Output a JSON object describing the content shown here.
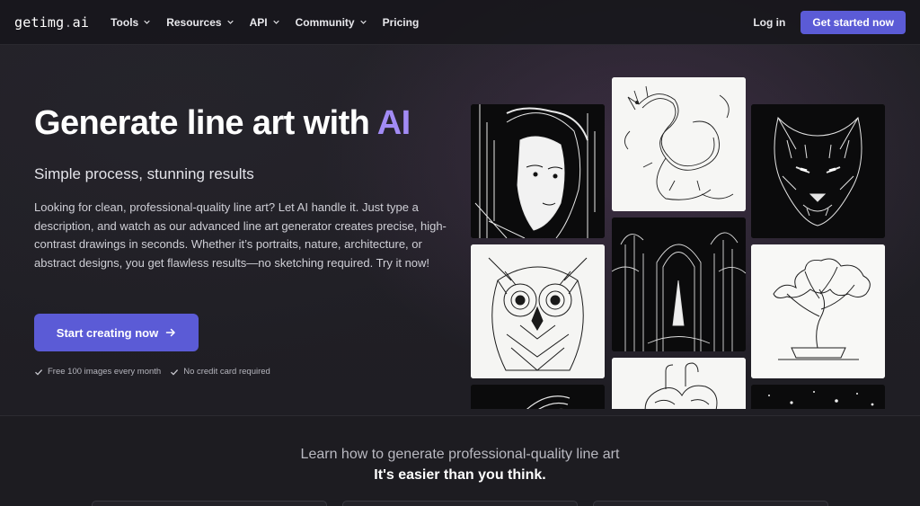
{
  "nav": {
    "logo_main": "getimg",
    "logo_dot": ".",
    "logo_tail": "ai",
    "items": [
      {
        "label": "Tools",
        "has_dropdown": true
      },
      {
        "label": "Resources",
        "has_dropdown": true
      },
      {
        "label": "API",
        "has_dropdown": true
      },
      {
        "label": "Community",
        "has_dropdown": true
      },
      {
        "label": "Pricing",
        "has_dropdown": false
      }
    ],
    "login_label": "Log in",
    "cta_label": "Get started now"
  },
  "hero": {
    "headline_start": "Generate line art with ",
    "headline_accent": "AI",
    "subheadline": "Simple process, stunning results",
    "description": "Looking for clean, professional-quality line art? Let AI handle it. Just type a description, and watch as our advanced line art generator creates precise, high-contrast drawings in seconds. Whether it’s portraits, nature, architecture, or abstract designs, you get flawless results—no sketching required. Try it now!",
    "cta_label": "Start creating now",
    "checks": [
      "Free 100 images every month",
      "No credit card required"
    ]
  },
  "gallery": {
    "images": [
      {
        "icon": "woman-portrait-image",
        "theme": "dark"
      },
      {
        "icon": "owl-image",
        "theme": "light"
      },
      {
        "icon": "abstract-swirl-image",
        "theme": "dark"
      },
      {
        "icon": "dragon-image",
        "theme": "light"
      },
      {
        "icon": "forest-archway-image",
        "theme": "dark"
      },
      {
        "icon": "heart-anatomy-image",
        "theme": "light"
      },
      {
        "icon": "wolf-image",
        "theme": "dark"
      },
      {
        "icon": "bonsai-tree-image",
        "theme": "light"
      },
      {
        "icon": "starfield-image",
        "theme": "dark"
      }
    ]
  },
  "learn": {
    "title": "Learn how to generate professional-quality line art",
    "subtitle": "It's easier than you think."
  },
  "colors": {
    "accent": "#5b5bd6",
    "headline_accent": "#a28bf5",
    "background": "#1d1c21"
  }
}
